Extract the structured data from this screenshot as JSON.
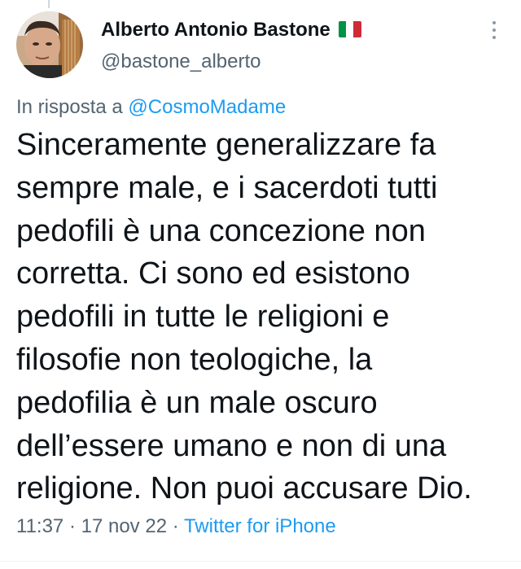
{
  "author": {
    "display_name": "Alberto Antonio Bastone",
    "flag_icon": "italy-flag-icon",
    "handle": "@bastone_alberto",
    "avatar_icon": "profile-photo"
  },
  "more_icon": "vertical-ellipsis-icon",
  "reply": {
    "prefix": "In risposta a",
    "mention": "@CosmoMadame"
  },
  "tweet": {
    "lines": [
      "Sinceramente generalizzare fa",
      "sempre male, e i sacerdoti tutti",
      "pedofili è una concezione non",
      "corretta. Ci sono ed esistono",
      "pedofili in tutte le religioni e",
      "filosofie non teologiche, la",
      "pedofilia è un male oscuro",
      "dell’essere umano e non di una",
      "religione. Non puoi accusare Dio."
    ]
  },
  "meta": {
    "time": "11:37",
    "separator": "·",
    "date": "17 nov 22",
    "source": "Twitter for iPhone"
  },
  "colors": {
    "text": "#0f1419",
    "secondary": "#536471",
    "link": "#1d9bf0",
    "flag_green": "#009246",
    "flag_white": "#ffffff",
    "flag_red": "#ce2b37"
  }
}
